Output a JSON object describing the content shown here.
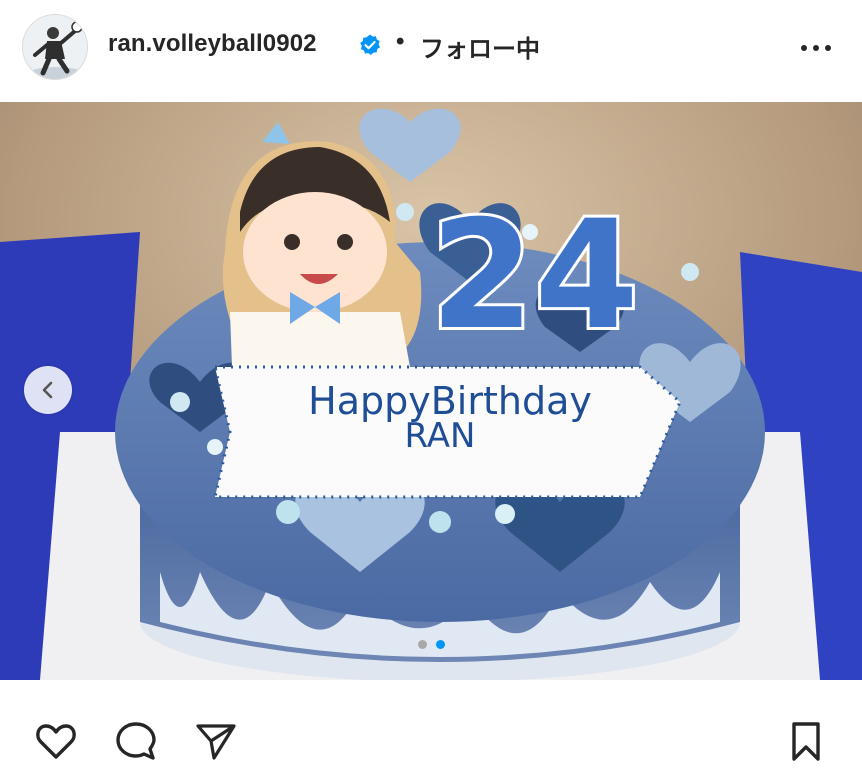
{
  "post": {
    "username": "ran.volleyball0902",
    "separator": "•",
    "follow_status": "フォロー中",
    "verified": true,
    "image": {
      "cake_message_line1": "HappyBirthday",
      "cake_message_line2": "RAN",
      "cake_number": "24"
    },
    "carousel": {
      "total": 2,
      "current": 2
    }
  },
  "icons": {
    "avatar": "profile-avatar",
    "verified": "verified-badge-icon",
    "more": "more-options-icon",
    "prev": "chevron-left-icon",
    "like": "heart-icon",
    "comment": "comment-bubble-icon",
    "share": "paper-plane-icon",
    "save": "bookmark-icon"
  },
  "colors": {
    "verified_blue": "#0095f6",
    "dot_active": "#0095f6",
    "dot_inactive": "#a8a8a8",
    "text": "#262626"
  }
}
